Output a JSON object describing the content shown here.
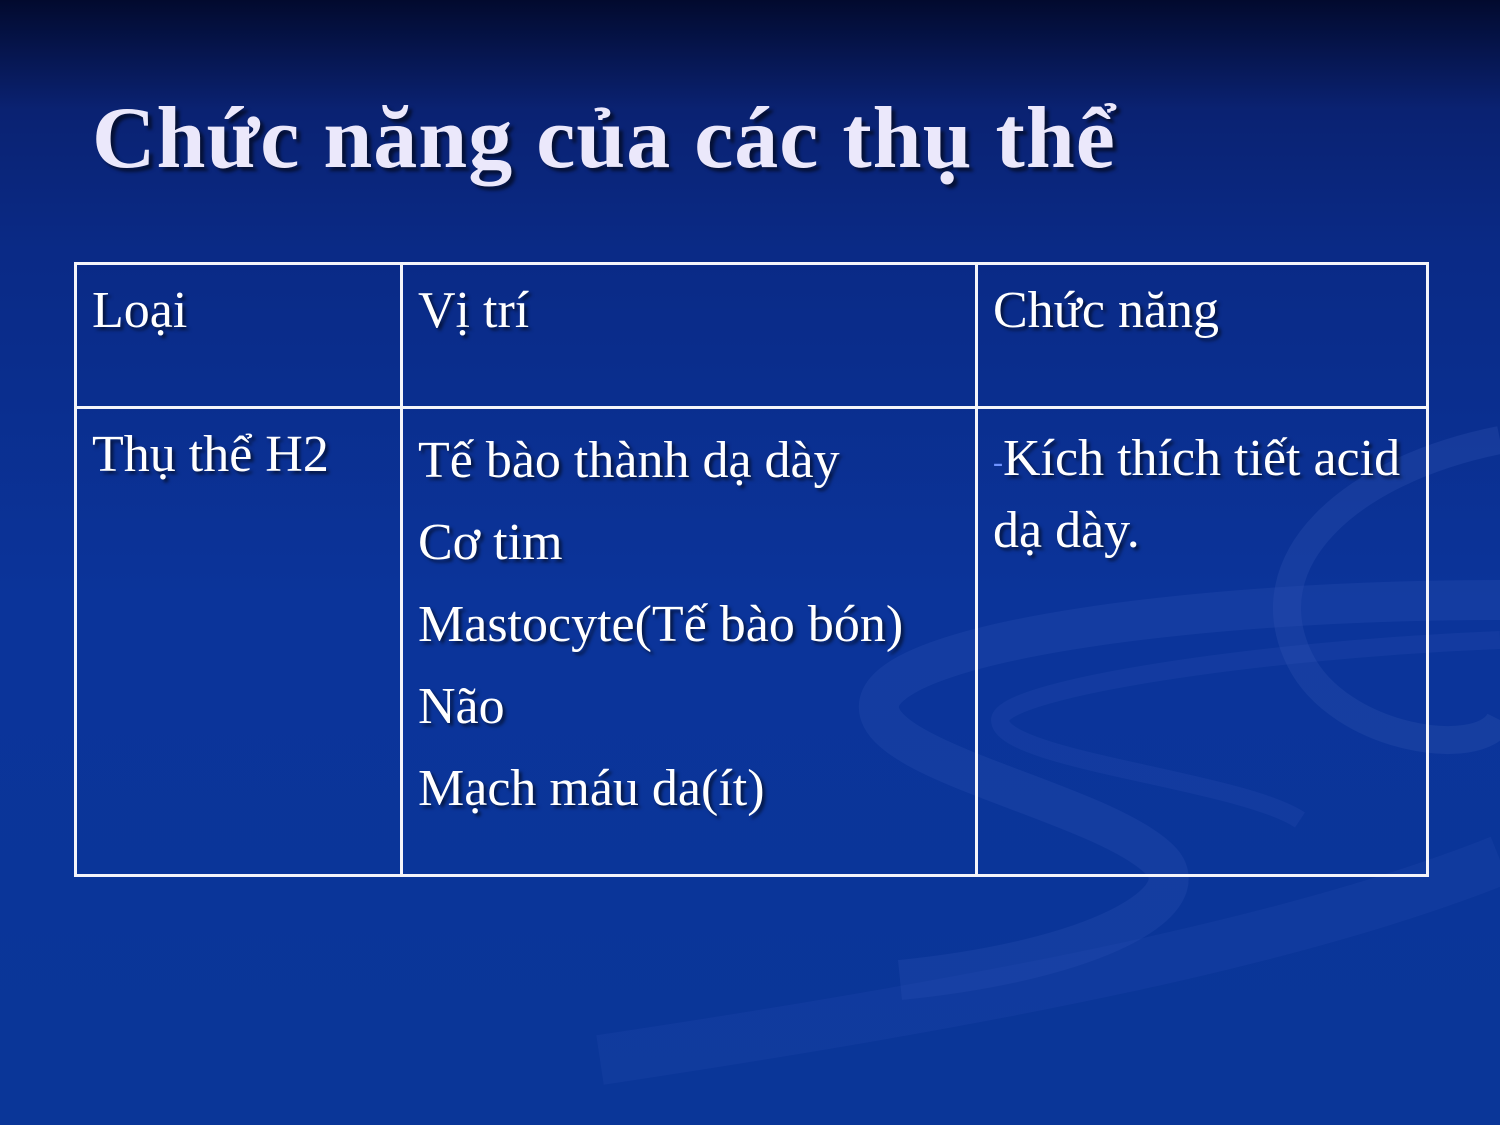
{
  "slide": {
    "title": "Chức năng của các thụ thể"
  },
  "table": {
    "headers": [
      "Loại",
      "Vị trí",
      "Chức năng"
    ],
    "rows": [
      {
        "type": "Thụ thể H2",
        "locations": [
          "Tế bào thành dạ dày",
          "Cơ tim",
          "Mastocyte(Tế bào bón)",
          "Não",
          "Mạch máu da(ít)"
        ],
        "function_bullet": "-",
        "function": "Kích thích tiết acid dạ dày."
      }
    ]
  },
  "colors": {
    "background_top": "#020a2e",
    "background_main": "#0b349a",
    "title_text": "#ebe8fb",
    "table_border": "#f4f4fa",
    "table_text": "#ffffff",
    "bullet": "#6f93ff"
  }
}
